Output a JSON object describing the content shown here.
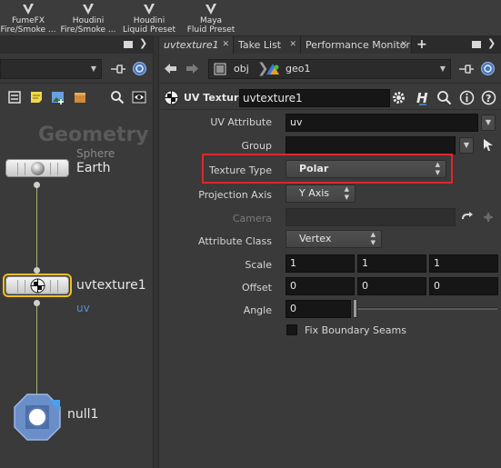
{
  "shelf": {
    "tools": [
      {
        "line1": "FumeFX",
        "line2": "Fire/Smoke ..."
      },
      {
        "line1": "Houdini",
        "line2": "Fire/Smoke ..."
      },
      {
        "line1": "Houdini",
        "line2": "Liquid Preset"
      },
      {
        "line1": "Maya",
        "line2": "Fluid Preset"
      }
    ]
  },
  "network": {
    "context_label": "Geometry",
    "nodes": [
      {
        "type": "Sphere",
        "name": "Earth"
      },
      {
        "name": "uvtexture1",
        "sub": "uv"
      },
      {
        "name": "null1"
      }
    ]
  },
  "tabs": [
    {
      "label": "uvtexture1"
    },
    {
      "label": "Take List"
    },
    {
      "label": "Performance Monitor"
    }
  ],
  "path": {
    "root": "obj",
    "node": "geo1"
  },
  "param_header": {
    "node_type": "UV Texture",
    "node_name": "uvtexture1"
  },
  "params": {
    "uv_attribute": {
      "label": "UV Attribute",
      "value": "uv"
    },
    "group": {
      "label": "Group",
      "value": ""
    },
    "texture_type": {
      "label": "Texture Type",
      "value": "Polar"
    },
    "projection_axis": {
      "label": "Projection Axis",
      "value": "Y Axis"
    },
    "camera": {
      "label": "Camera",
      "value": ""
    },
    "attribute_class": {
      "label": "Attribute Class",
      "value": "Vertex"
    },
    "scale": {
      "label": "Scale",
      "x": "1",
      "y": "1",
      "z": "1"
    },
    "offset": {
      "label": "Offset",
      "x": "0",
      "y": "0",
      "z": "0"
    },
    "angle": {
      "label": "Angle",
      "value": "0"
    },
    "fix_boundary": {
      "label": "Fix Boundary Seams",
      "checked": false
    }
  },
  "colors": {
    "highlight": "#e0262b",
    "selected_node_outline": "#f0c020",
    "wire": "#a8b070"
  }
}
